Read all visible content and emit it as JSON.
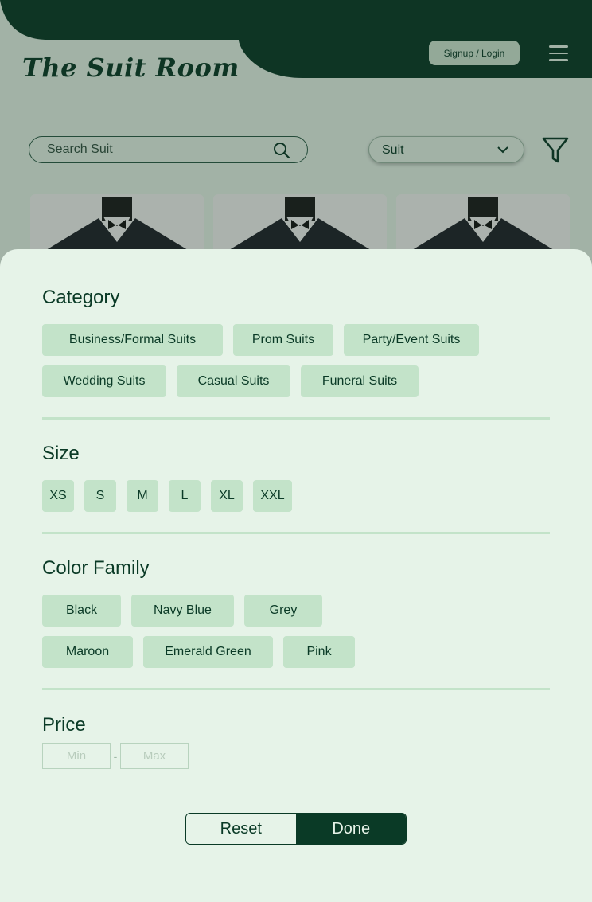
{
  "header": {
    "logo_text": "The Suit Room",
    "signup_label": "Signup / Login"
  },
  "search": {
    "placeholder": "Search Suit"
  },
  "type_select": {
    "value": "Suit"
  },
  "filters": {
    "category": {
      "title": "Category",
      "rows": [
        [
          "Business/Formal Suits",
          "Prom Suits",
          "Party/Event Suits"
        ],
        [
          "Wedding Suits",
          "Casual Suits",
          "Funeral Suits"
        ]
      ]
    },
    "size": {
      "title": "Size",
      "options": [
        "XS",
        "S",
        "M",
        "L",
        "XL",
        "XXL"
      ]
    },
    "color_family": {
      "title": "Color Family",
      "rows": [
        [
          "Black",
          "Navy Blue",
          "Grey"
        ],
        [
          "Maroon",
          "Emerald Green",
          "Pink"
        ]
      ]
    },
    "price": {
      "title": "Price",
      "min_placeholder": "Min",
      "separator": "-",
      "max_placeholder": "Max"
    }
  },
  "actions": {
    "reset_label": "Reset",
    "done_label": "Done"
  },
  "colors": {
    "brand_dark": "#0a3a26",
    "background": "#e6f3e8",
    "chip": "#c3e3c9"
  }
}
